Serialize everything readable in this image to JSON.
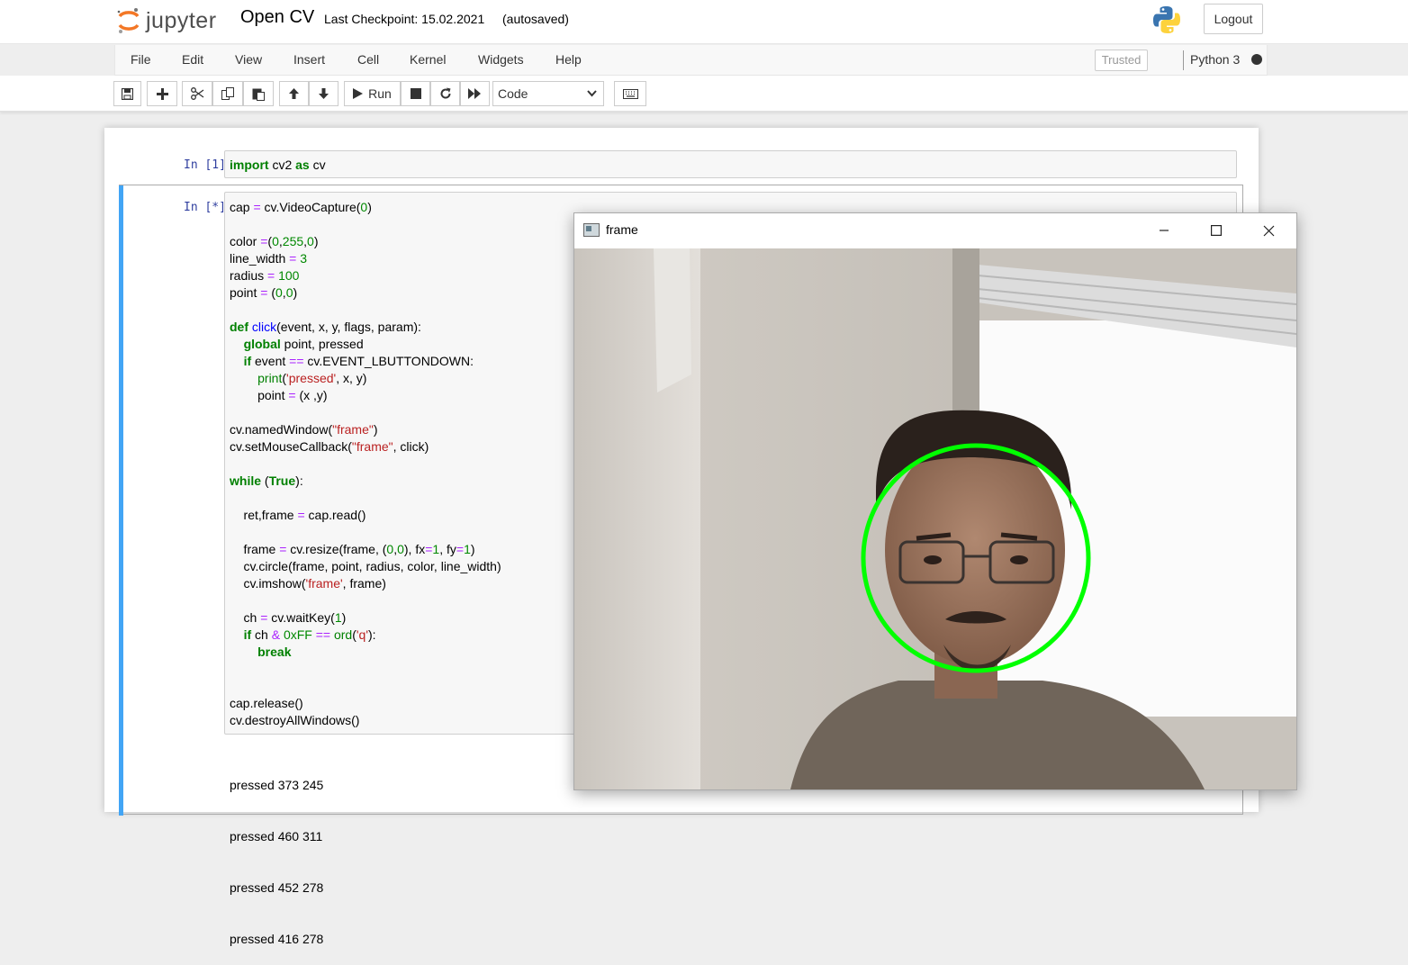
{
  "header": {
    "logo_text": "jupyter",
    "notebook_name": "Open CV",
    "checkpoint": "Last Checkpoint: 15.02.2021",
    "autosave": "(autosaved)",
    "logout_label": "Logout"
  },
  "menubar": {
    "items": [
      "File",
      "Edit",
      "View",
      "Insert",
      "Cell",
      "Kernel",
      "Widgets",
      "Help"
    ],
    "trusted_label": "Trusted",
    "kernel_name": "Python 3"
  },
  "toolbar": {
    "run_label": "Run",
    "cell_type": "Code",
    "buttons": [
      "save-icon",
      "plus-icon",
      "cut-icon",
      "copy-icon",
      "paste-icon",
      "arrow-up-icon",
      "arrow-down-icon",
      "play-icon",
      "stop-icon",
      "restart-icon",
      "fast-forward-icon",
      "keyboard-icon"
    ]
  },
  "cells": [
    {
      "prompt": "In [1]:",
      "lines": [
        [
          {
            "t": "import",
            "c": "kw"
          },
          {
            "t": " cv2 "
          },
          {
            "t": "as",
            "c": "kw"
          },
          {
            "t": " cv"
          }
        ]
      ]
    },
    {
      "prompt": "In [*]:",
      "lines": [
        [
          {
            "t": "cap "
          },
          {
            "t": "=",
            "c": "op"
          },
          {
            "t": " cv.VideoCapture("
          },
          {
            "t": "0",
            "c": "nm"
          },
          {
            "t": ")"
          }
        ],
        [],
        [
          {
            "t": "color "
          },
          {
            "t": "=",
            "c": "op"
          },
          {
            "t": "("
          },
          {
            "t": "0",
            "c": "nm"
          },
          {
            "t": ","
          },
          {
            "t": "255",
            "c": "nm"
          },
          {
            "t": ","
          },
          {
            "t": "0",
            "c": "nm"
          },
          {
            "t": ")"
          }
        ],
        [
          {
            "t": "line_width "
          },
          {
            "t": "=",
            "c": "op"
          },
          {
            "t": " "
          },
          {
            "t": "3",
            "c": "nm"
          }
        ],
        [
          {
            "t": "radius "
          },
          {
            "t": "=",
            "c": "op"
          },
          {
            "t": " "
          },
          {
            "t": "100",
            "c": "nm"
          }
        ],
        [
          {
            "t": "point "
          },
          {
            "t": "=",
            "c": "op"
          },
          {
            "t": " ("
          },
          {
            "t": "0",
            "c": "nm"
          },
          {
            "t": ","
          },
          {
            "t": "0",
            "c": "nm"
          },
          {
            "t": ")"
          }
        ],
        [],
        [
          {
            "t": "def",
            "c": "kw"
          },
          {
            "t": " "
          },
          {
            "t": "click",
            "c": "fn"
          },
          {
            "t": "(event, x, y, flags, param):"
          }
        ],
        [
          {
            "t": "    "
          },
          {
            "t": "global",
            "c": "kw"
          },
          {
            "t": " point, pressed"
          }
        ],
        [
          {
            "t": "    "
          },
          {
            "t": "if",
            "c": "kw"
          },
          {
            "t": " event "
          },
          {
            "t": "==",
            "c": "op"
          },
          {
            "t": " cv.EVENT_LBUTTONDOWN:"
          }
        ],
        [
          {
            "t": "        "
          },
          {
            "t": "print",
            "c": "bi"
          },
          {
            "t": "("
          },
          {
            "t": "'pressed'",
            "c": "st"
          },
          {
            "t": ", x, y)"
          }
        ],
        [
          {
            "t": "        point "
          },
          {
            "t": "=",
            "c": "op"
          },
          {
            "t": " (x ,y)"
          }
        ],
        [],
        [
          {
            "t": "cv.namedWindow("
          },
          {
            "t": "\"frame\"",
            "c": "st"
          },
          {
            "t": ")"
          }
        ],
        [
          {
            "t": "cv.setMouseCallback("
          },
          {
            "t": "\"frame\"",
            "c": "st"
          },
          {
            "t": ", click)"
          }
        ],
        [],
        [
          {
            "t": "while",
            "c": "kw"
          },
          {
            "t": " ("
          },
          {
            "t": "True",
            "c": "kw"
          },
          {
            "t": "):"
          }
        ],
        [],
        [
          {
            "t": "    ret,frame "
          },
          {
            "t": "=",
            "c": "op"
          },
          {
            "t": " cap.read()"
          }
        ],
        [],
        [
          {
            "t": "    frame "
          },
          {
            "t": "=",
            "c": "op"
          },
          {
            "t": " cv.resize(frame, ("
          },
          {
            "t": "0",
            "c": "nm"
          },
          {
            "t": ","
          },
          {
            "t": "0",
            "c": "nm"
          },
          {
            "t": "), fx"
          },
          {
            "t": "=",
            "c": "op"
          },
          {
            "t": "1",
            "c": "nm"
          },
          {
            "t": ", fy"
          },
          {
            "t": "=",
            "c": "op"
          },
          {
            "t": "1",
            "c": "nm"
          },
          {
            "t": ")"
          }
        ],
        [
          {
            "t": "    cv.circle(frame, point, radius, color, line_width)"
          }
        ],
        [
          {
            "t": "    cv.imshow("
          },
          {
            "t": "'frame'",
            "c": "st"
          },
          {
            "t": ", frame)"
          }
        ],
        [],
        [
          {
            "t": "    ch "
          },
          {
            "t": "=",
            "c": "op"
          },
          {
            "t": " cv.waitKey("
          },
          {
            "t": "1",
            "c": "nm"
          },
          {
            "t": ")"
          }
        ],
        [
          {
            "t": "    "
          },
          {
            "t": "if",
            "c": "kw"
          },
          {
            "t": " ch "
          },
          {
            "t": "&",
            "c": "op"
          },
          {
            "t": " "
          },
          {
            "t": "0xFF",
            "c": "nm"
          },
          {
            "t": " "
          },
          {
            "t": "==",
            "c": "op"
          },
          {
            "t": " "
          },
          {
            "t": "ord",
            "c": "bi"
          },
          {
            "t": "("
          },
          {
            "t": "'q'",
            "c": "st"
          },
          {
            "t": "):"
          }
        ],
        [
          {
            "t": "        "
          },
          {
            "t": "break",
            "c": "kw"
          }
        ],
        [],
        [],
        [
          {
            "t": "cap.release()"
          }
        ],
        [
          {
            "t": "cv.destroyAllWindows()"
          }
        ]
      ],
      "output": [
        "pressed 373 245",
        "pressed 460 311",
        "pressed 452 278",
        "pressed 416 278"
      ]
    }
  ],
  "window": {
    "title": "frame",
    "minimize_icon": "minimize-icon",
    "maximize_icon": "maximize-icon",
    "close_icon": "close-icon",
    "overlay_circle_color": "#00ff00"
  },
  "colors": {
    "prompt": "#303f9f",
    "selected_cell_bar": "#42a5f5"
  }
}
